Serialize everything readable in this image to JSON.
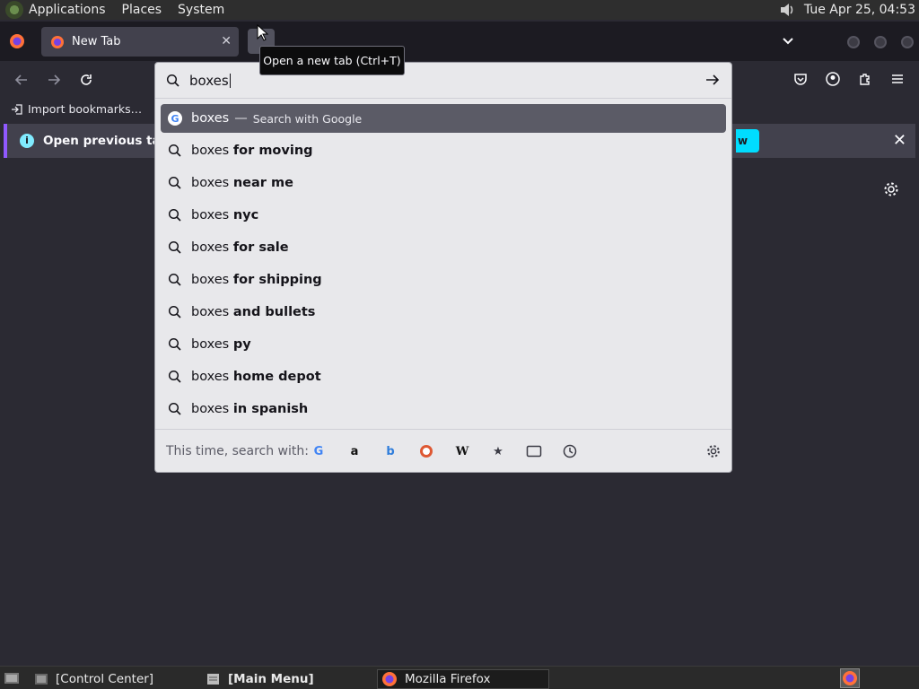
{
  "system_panel": {
    "menus": [
      "Applications",
      "Places",
      "System"
    ],
    "clock": "Tue Apr 25, 04:53"
  },
  "tabs": [
    {
      "title": "New Tab"
    }
  ],
  "bookmarks_bar": {
    "import_label": "Import bookmarks…"
  },
  "notification": {
    "message": "Open previous tabs?",
    "button_label": "w"
  },
  "urlbar": {
    "query": "boxes",
    "suggestions": [
      {
        "base": "boxes",
        "rest": "",
        "action": "Search with Google",
        "selected": true
      },
      {
        "base": "boxes",
        "rest": "for moving"
      },
      {
        "base": "boxes",
        "rest": "near me"
      },
      {
        "base": "boxes",
        "rest": "nyc"
      },
      {
        "base": "boxes",
        "rest": "for sale"
      },
      {
        "base": "boxes",
        "rest": "for shipping"
      },
      {
        "base": "boxes",
        "rest": "and bullets"
      },
      {
        "base": "boxes",
        "rest": "py"
      },
      {
        "base": "boxes",
        "rest": "home depot"
      },
      {
        "base": "boxes",
        "rest": "in spanish"
      }
    ],
    "oneoff_label": "This time, search with:",
    "engines": [
      "google-icon",
      "amazon-icon",
      "bing-icon",
      "duckduckgo-icon",
      "wikipedia-icon",
      "bookmarks-icon",
      "tabs-icon",
      "history-icon"
    ]
  },
  "tooltip": "Open a new tab (Ctrl+T)",
  "taskbar": {
    "items": [
      "[Control Center]",
      "[Main Menu]",
      "Mozilla Firefox"
    ]
  },
  "colors": {
    "accent": "#9059ff",
    "info": "#80ebff",
    "button": "#00ddff"
  }
}
